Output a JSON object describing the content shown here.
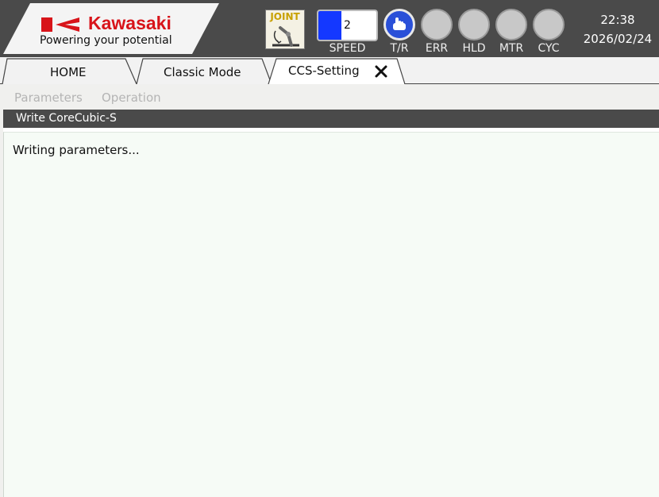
{
  "brand": {
    "name": "Kawasaki",
    "tagline": "Powering your potential"
  },
  "status_bar": {
    "mode": "JOINT",
    "speed": {
      "value": "2",
      "label": "SPEED",
      "fill_fraction": 0.4
    },
    "lamps": [
      {
        "id": "tr",
        "label": "T/R",
        "active": true,
        "icon": "hand-pointer-icon"
      },
      {
        "id": "err",
        "label": "ERR",
        "active": false
      },
      {
        "id": "hld",
        "label": "HLD",
        "active": false
      },
      {
        "id": "mtr",
        "label": "MTR",
        "active": false
      },
      {
        "id": "cyc",
        "label": "CYC",
        "active": false
      }
    ],
    "time": "22:38",
    "date": "2026/02/24"
  },
  "tabs": [
    {
      "label": "HOME",
      "active": false
    },
    {
      "label": "Classic Mode",
      "active": false
    },
    {
      "label": "CCS-Setting",
      "active": true,
      "closable": true
    }
  ],
  "menu": {
    "items": [
      "Parameters",
      "Operation"
    ],
    "enabled": false
  },
  "panel": {
    "title": "Write CoreCubic-S",
    "message": "Writing parameters..."
  },
  "colors": {
    "brand_red": "#d8141a",
    "speed_blue": "#1438ff",
    "tr_lamp": "#2a50d8",
    "header_dark": "#4a4a4a",
    "lamp_off": "#c8c8c8"
  }
}
